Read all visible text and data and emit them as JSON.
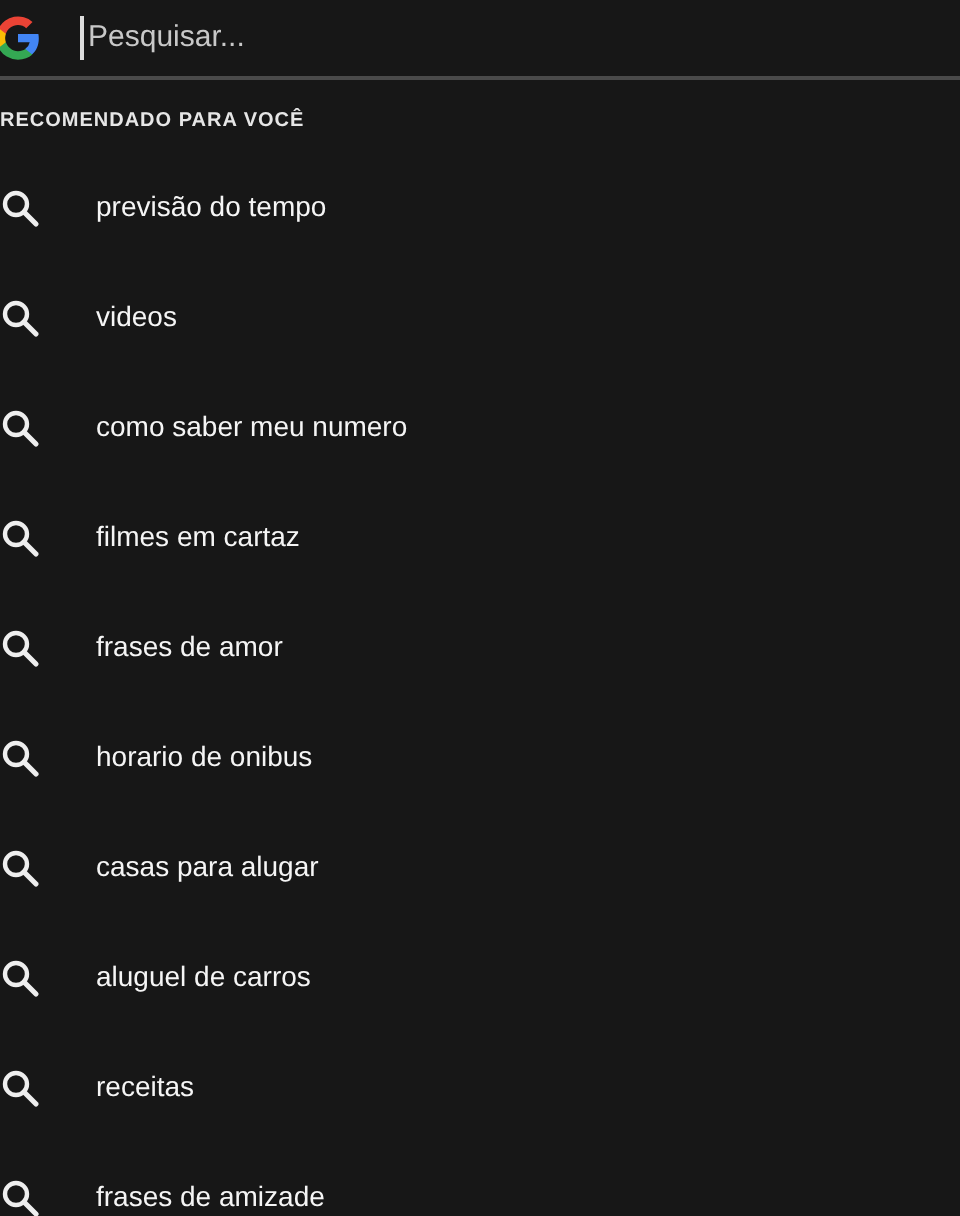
{
  "search": {
    "placeholder": "Pesquisar..."
  },
  "section_title": "RECOMENDADO PARA VOCÊ",
  "suggestions": [
    {
      "text": "previsão do tempo"
    },
    {
      "text": "videos"
    },
    {
      "text": "como saber meu numero"
    },
    {
      "text": "filmes em cartaz"
    },
    {
      "text": "frases de amor"
    },
    {
      "text": "horario de onibus"
    },
    {
      "text": "casas para alugar"
    },
    {
      "text": "aluguel de carros"
    },
    {
      "text": "receitas"
    },
    {
      "text": "frases de amizade"
    }
  ]
}
